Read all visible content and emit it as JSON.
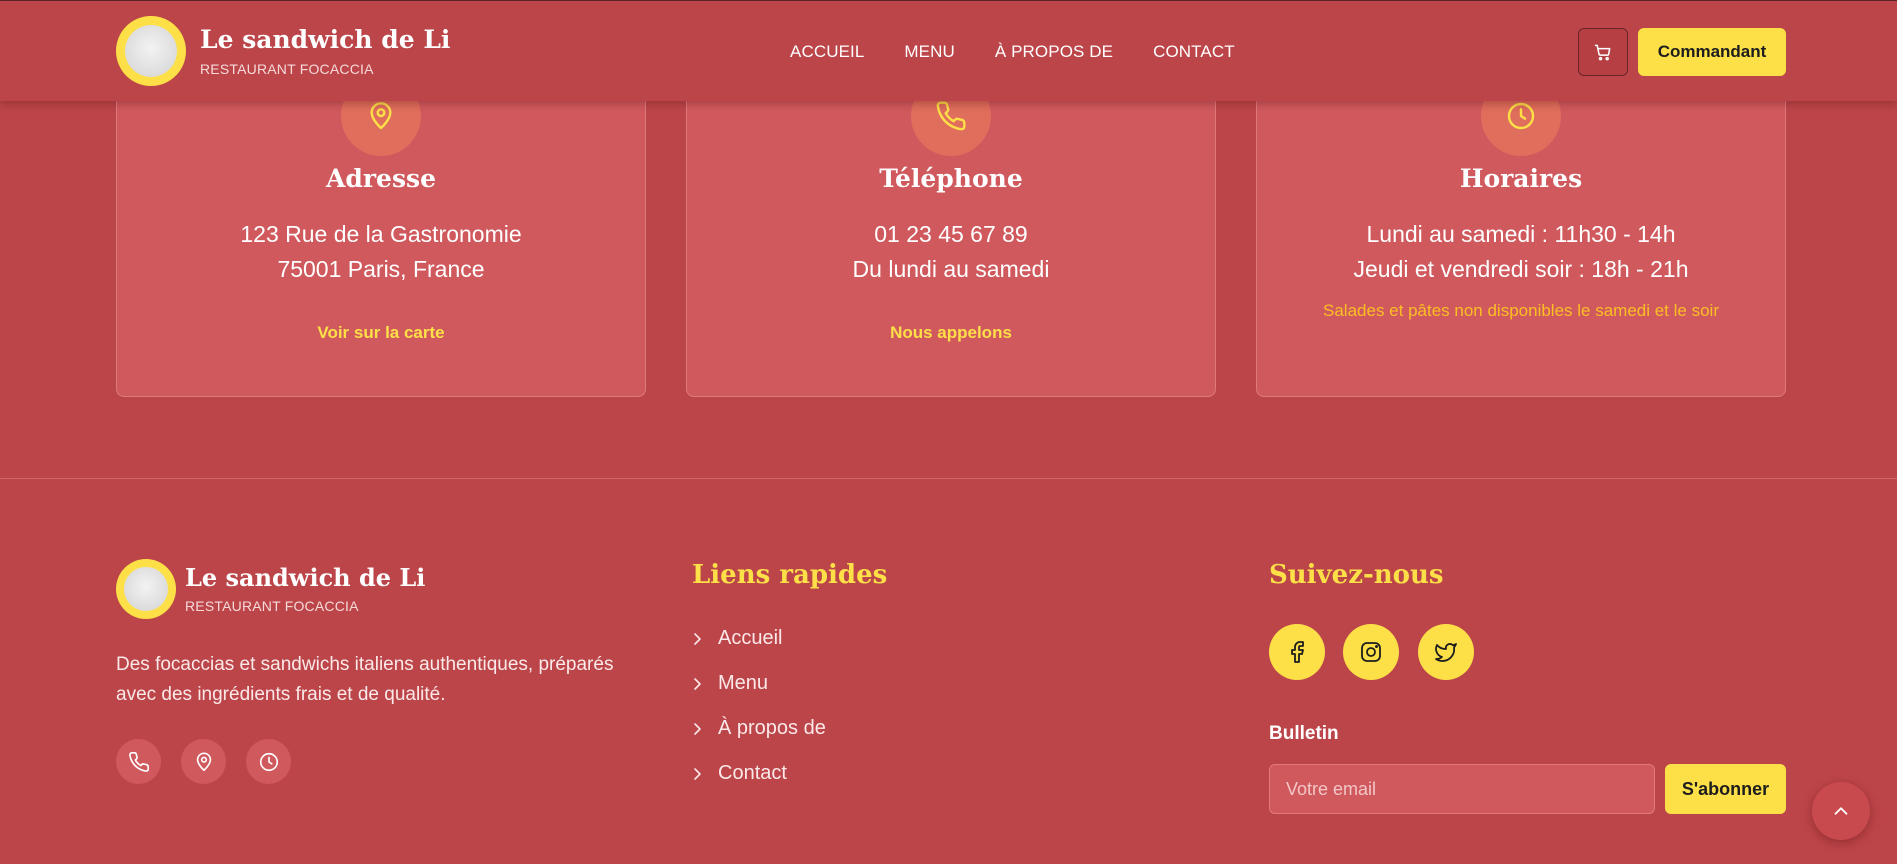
{
  "header": {
    "brand_name": "Le sandwich de Li",
    "brand_sub": "RESTAURANT FOCACCIA",
    "nav": [
      "ACCUEIL",
      "MENU",
      "À PROPOS DE",
      "CONTACT"
    ],
    "cart_icon": "cart-icon",
    "order_label": "Commandant"
  },
  "cards": [
    {
      "icon": "map-pin-icon",
      "title": "Adresse",
      "lines": [
        "123 Rue de la Gastronomie",
        "75001 Paris, France"
      ],
      "link": "Voir sur la carte"
    },
    {
      "icon": "phone-icon",
      "title": "Téléphone",
      "lines": [
        "01 23 45 67 89",
        "Du lundi au samedi"
      ],
      "link": "Nous appelons"
    },
    {
      "icon": "clock-icon",
      "title": "Horaires",
      "lines": [
        "Lundi au samedi : 11h30 - 14h",
        "Jeudi et vendredi soir : 18h - 21h"
      ],
      "note": "Salades et pâtes non disponibles le samedi et le soir"
    }
  ],
  "footer": {
    "brand_name": "Le sandwich de Li",
    "brand_sub": "RESTAURANT FOCACCIA",
    "description": "Des focaccias et sandwichs italiens authentiques, préparés avec des ingrédients frais et de qualité.",
    "contact_icons": [
      "phone-icon",
      "map-pin-icon",
      "clock-icon"
    ],
    "quick_links_title": "Liens rapides",
    "quick_links": [
      "Accueil",
      "Menu",
      "À propos de",
      "Contact"
    ],
    "follow_title": "Suivez-nous",
    "social_icons": [
      "facebook-icon",
      "instagram-icon",
      "twitter-icon"
    ],
    "newsletter_label": "Bulletin",
    "email_placeholder": "Votre email",
    "subscribe_label": "S'abonner"
  },
  "colors": {
    "background": "#bc4549",
    "card": "#d0595d",
    "accent_yellow": "#fde047",
    "note_orange": "#fbbf24"
  }
}
